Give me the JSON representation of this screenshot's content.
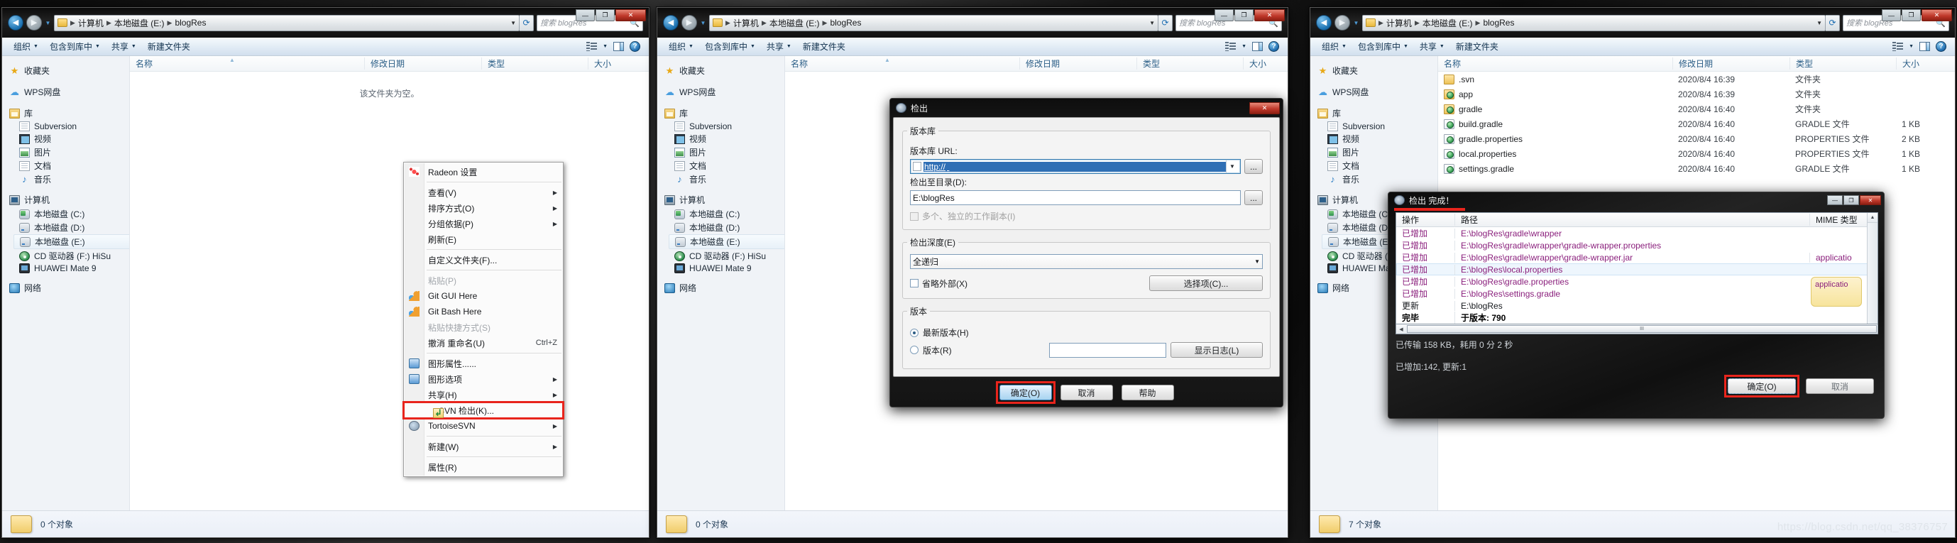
{
  "explorer": {
    "breadcrumb": [
      "计算机",
      "本地磁盘 (E:)",
      "blogRes"
    ],
    "search_placeholder": "搜索 blogRes",
    "toolbar": {
      "organize": "组织",
      "include_in_library": "包含到库中",
      "share": "共享",
      "new_folder": "新建文件夹"
    },
    "columns": [
      "名称",
      "修改日期",
      "类型",
      "大小"
    ],
    "sidebar": {
      "favorites": "收藏夹",
      "wps": "WPS网盘",
      "library": "库",
      "library_items": [
        "Subversion",
        "视频",
        "图片",
        "文档",
        "音乐"
      ],
      "computer": "计算机",
      "computer_items": [
        "本地磁盘 (C:)",
        "本地磁盘 (D:)",
        "本地磁盘 (E:)",
        "CD 驱动器 (F:) HiSu",
        "HUAWEI Mate 9"
      ],
      "network": "网络"
    },
    "empty_message": "该文件夹为空。",
    "status_empty": "0 个对象",
    "status_filled": "7 个对象",
    "files": [
      {
        "name": ".svn",
        "date": "2020/8/4 16:39",
        "type": "文件夹",
        "size": "",
        "icon": "folder"
      },
      {
        "name": "app",
        "date": "2020/8/4 16:39",
        "type": "文件夹",
        "size": "",
        "icon": "folder-svn"
      },
      {
        "name": "gradle",
        "date": "2020/8/4 16:40",
        "type": "文件夹",
        "size": "",
        "icon": "folder-svn"
      },
      {
        "name": "build.gradle",
        "date": "2020/8/4 16:40",
        "type": "GRADLE 文件",
        "size": "1 KB",
        "icon": "file-svn"
      },
      {
        "name": "gradle.properties",
        "date": "2020/8/4 16:40",
        "type": "PROPERTIES 文件",
        "size": "2 KB",
        "icon": "file-svn"
      },
      {
        "name": "local.properties",
        "date": "2020/8/4 16:40",
        "type": "PROPERTIES 文件",
        "size": "1 KB",
        "icon": "file-svn"
      },
      {
        "name": "settings.gradle",
        "date": "2020/8/4 16:40",
        "type": "GRADLE 文件",
        "size": "1 KB",
        "icon": "file-svn"
      }
    ]
  },
  "context_menu": {
    "items": [
      {
        "label": "Radeon 设置",
        "icon": "radeon-icon"
      },
      {
        "label": "查看(V)",
        "arrow": "▶"
      },
      {
        "label": "排序方式(O)",
        "arrow": "▶"
      },
      {
        "label": "分组依据(P)",
        "arrow": "▶"
      },
      {
        "label": "刷新(E)"
      },
      {
        "label": "自定义文件夹(F)..."
      },
      {
        "label": "粘贴(P)",
        "disabled": true
      },
      {
        "label": "Git GUI Here",
        "icon": "git-icon"
      },
      {
        "label": "Git Bash Here",
        "icon": "git-icon"
      },
      {
        "label": "粘贴快捷方式(S)",
        "disabled": true
      },
      {
        "label": "撤消 重命名(U)",
        "accel": "Ctrl+Z"
      },
      {
        "label": "图形属性......",
        "icon": "graphics-icon"
      },
      {
        "label": "图形选项",
        "icon": "graphics-icon",
        "arrow": "▶"
      },
      {
        "label": "共享(H)",
        "arrow": "▶"
      },
      {
        "label": "SVN 检出(K)...",
        "icon": "svn-checkout-icon",
        "highlight": true
      },
      {
        "label": "TortoiseSVN",
        "icon": "tortoisesvn-icon",
        "arrow": "▶"
      },
      {
        "label": "新建(W)",
        "arrow": "▶"
      },
      {
        "label": "属性(R)"
      }
    ]
  },
  "checkout_dialog": {
    "title": "检出",
    "repo_group": "版本库",
    "url_label": "版本库 URL:",
    "url_value": "http://",
    "target_label": "检出至目录(D):",
    "target_value": "E:\\blogRes",
    "multiple_wc_label": "多个、独立的工作副本(I)",
    "depth_group": "检出深度(E)",
    "depth_value": "全递归",
    "omit_externals_label": "省略外部(X)",
    "choose_items_button": "选择项(C)...",
    "revision_group": "版本",
    "head_revision_label": "最新版本(H)",
    "revision_label": "版本(R)",
    "revision_value": "",
    "show_log_button": "显示日志(L)",
    "ok_button": "确定(O)",
    "cancel_button": "取消",
    "help_button": "帮助",
    "browse_button": "..."
  },
  "finished_dialog": {
    "title": "检出 完成！",
    "columns": [
      "操作",
      "路径",
      "MIME 类型"
    ],
    "rows": [
      {
        "action": "已增加",
        "path": "E:\\blogRes\\gradle\\wrapper",
        "mime": ""
      },
      {
        "action": "已增加",
        "path": "E:\\blogRes\\gradle\\wrapper\\gradle-wrapper.properties",
        "mime": ""
      },
      {
        "action": "已增加",
        "path": "E:\\blogRes\\gradle\\wrapper\\gradle-wrapper.jar",
        "mime": "applicatio"
      },
      {
        "action": "已增加",
        "path": "E:\\blogRes\\local.properties",
        "mime": "",
        "selected": true
      },
      {
        "action": "已增加",
        "path": "E:\\blogRes\\gradle.properties",
        "mime": ""
      },
      {
        "action": "已增加",
        "path": "E:\\blogRes\\settings.gradle",
        "mime": ""
      },
      {
        "action": "更新",
        "path": "E:\\blogRes",
        "mime": ""
      },
      {
        "action": "完毕",
        "path": "于版本: 790",
        "mime": ""
      }
    ],
    "transfer_status": "已传输 158 KB，耗用 0 分 2 秒",
    "summary_status": "已增加:142, 更新:1",
    "ok_button": "确定(O)",
    "cancel_button": "取消"
  },
  "watermark": "https://blog.csdn.net/qq_38376757",
  "colors": {
    "highlight": "#e8241c",
    "accent": "#3c7fb1",
    "added_text": "#8a1f7c"
  }
}
